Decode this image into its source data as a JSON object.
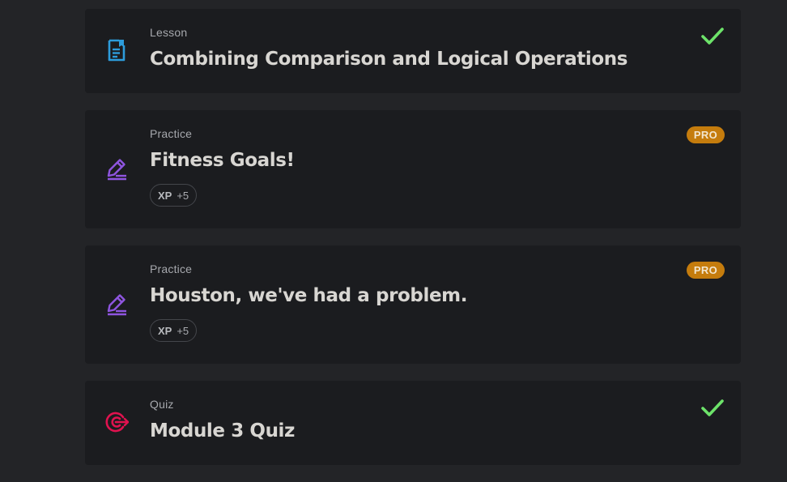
{
  "items": [
    {
      "type": "Lesson",
      "title": "Combining Comparison and Logical Operations",
      "icon": "lesson-document-icon",
      "status": "completed"
    },
    {
      "type": "Practice",
      "title": "Fitness Goals!",
      "icon": "practice-pencil-icon",
      "badge": "PRO",
      "xp_label": "XP",
      "xp_value": "+5"
    },
    {
      "type": "Practice",
      "title": "Houston, we've had a problem.",
      "icon": "practice-pencil-icon",
      "badge": "PRO",
      "xp_label": "XP",
      "xp_value": "+5"
    },
    {
      "type": "Quiz",
      "title": "Module 3 Quiz",
      "icon": "quiz-target-icon",
      "status": "completed"
    }
  ],
  "colors": {
    "page_bg": "#232427",
    "card_bg": "#1b1c1f",
    "lesson_icon": "#2d9cdb",
    "practice_icon": "#8f55e0",
    "quiz_icon": "#e0124f",
    "check": "#6de36a",
    "pro_badge": "#c57c0d"
  }
}
